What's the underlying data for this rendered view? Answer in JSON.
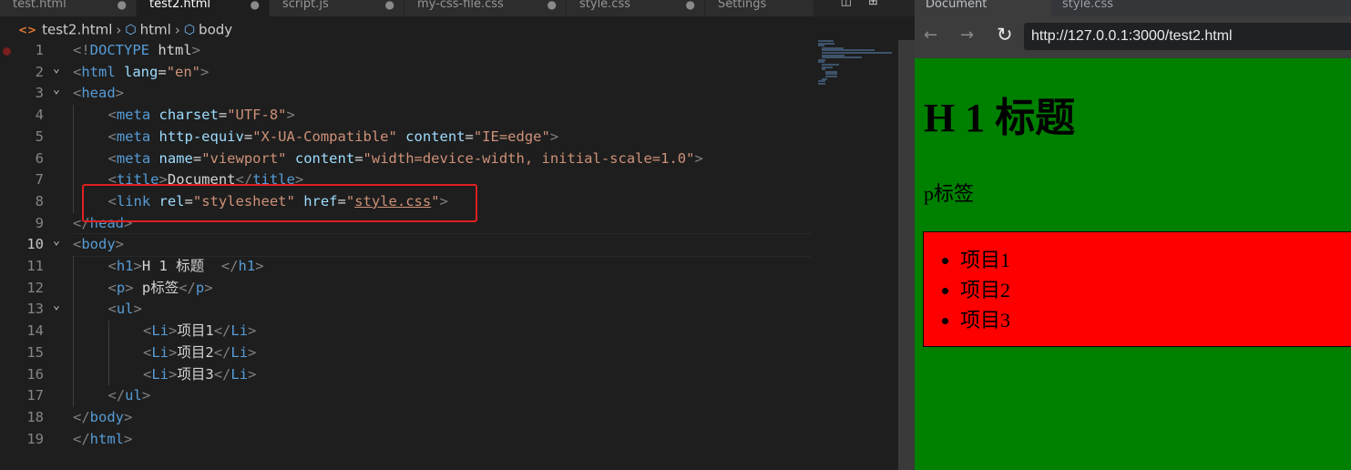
{
  "editor": {
    "tabs": [
      {
        "label": "test.html",
        "modified": "●",
        "active": false
      },
      {
        "label": "test2.html",
        "modified": "●",
        "active": true
      },
      {
        "label": "script.js",
        "modified": "●",
        "active": false
      },
      {
        "label": "my-css-file.css",
        "modified": "●",
        "active": false
      },
      {
        "label": "style.css",
        "modified": "●",
        "active": false
      },
      {
        "label": "Settings",
        "modified": "",
        "active": false
      }
    ],
    "breadcrumb": {
      "file": "test2.html",
      "items": [
        "html",
        "body"
      ]
    },
    "current_line": 10,
    "lines": [
      {
        "n": "1",
        "fold": "",
        "indent": 0,
        "tokens": [
          [
            "punct",
            "<!"
          ],
          [
            "tag",
            "DOCTYPE"
          ],
          [
            "txt",
            " html"
          ],
          [
            "punct",
            ">"
          ]
        ]
      },
      {
        "n": "2",
        "fold": "v",
        "indent": 0,
        "tokens": [
          [
            "punct",
            "<"
          ],
          [
            "tag",
            "html"
          ],
          [
            "txt",
            " "
          ],
          [
            "attr",
            "lang"
          ],
          [
            "txt",
            "="
          ],
          [
            "str",
            "\"en\""
          ],
          [
            "punct",
            ">"
          ]
        ]
      },
      {
        "n": "3",
        "fold": "v",
        "indent": 0,
        "tokens": [
          [
            "punct",
            "<"
          ],
          [
            "tag",
            "head"
          ],
          [
            "punct",
            ">"
          ]
        ]
      },
      {
        "n": "4",
        "fold": "",
        "indent": 1,
        "tokens": [
          [
            "punct",
            "<"
          ],
          [
            "tag",
            "meta"
          ],
          [
            "txt",
            " "
          ],
          [
            "attr",
            "charset"
          ],
          [
            "txt",
            "="
          ],
          [
            "str",
            "\"UTF-8\""
          ],
          [
            "punct",
            ">"
          ]
        ]
      },
      {
        "n": "5",
        "fold": "",
        "indent": 1,
        "tokens": [
          [
            "punct",
            "<"
          ],
          [
            "tag",
            "meta"
          ],
          [
            "txt",
            " "
          ],
          [
            "attr",
            "http-equiv"
          ],
          [
            "txt",
            "="
          ],
          [
            "str",
            "\"X-UA-Compatible\""
          ],
          [
            "txt",
            " "
          ],
          [
            "attr",
            "content"
          ],
          [
            "txt",
            "="
          ],
          [
            "str",
            "\"IE=edge\""
          ],
          [
            "punct",
            ">"
          ]
        ]
      },
      {
        "n": "6",
        "fold": "",
        "indent": 1,
        "tokens": [
          [
            "punct",
            "<"
          ],
          [
            "tag",
            "meta"
          ],
          [
            "txt",
            " "
          ],
          [
            "attr",
            "name"
          ],
          [
            "txt",
            "="
          ],
          [
            "str",
            "\"viewport\""
          ],
          [
            "txt",
            " "
          ],
          [
            "attr",
            "content"
          ],
          [
            "txt",
            "="
          ],
          [
            "str",
            "\"width=device-width, initial-scale=1.0\""
          ],
          [
            "punct",
            ">"
          ]
        ]
      },
      {
        "n": "7",
        "fold": "",
        "indent": 1,
        "tokens": [
          [
            "punct",
            "<"
          ],
          [
            "tag",
            "title"
          ],
          [
            "punct",
            ">"
          ],
          [
            "txt",
            "Document"
          ],
          [
            "punct",
            "</"
          ],
          [
            "tag",
            "title"
          ],
          [
            "punct",
            ">"
          ]
        ]
      },
      {
        "n": "8",
        "fold": "",
        "indent": 1,
        "tokens": [
          [
            "punct",
            "<"
          ],
          [
            "tag",
            "link"
          ],
          [
            "txt",
            " "
          ],
          [
            "attr",
            "rel"
          ],
          [
            "txt",
            "="
          ],
          [
            "str",
            "\"stylesheet\""
          ],
          [
            "txt",
            " "
          ],
          [
            "attr",
            "href"
          ],
          [
            "txt",
            "="
          ],
          [
            "str",
            "\""
          ],
          [
            "strul",
            "style.css"
          ],
          [
            "str",
            "\""
          ],
          [
            "punct",
            ">"
          ]
        ]
      },
      {
        "n": "9",
        "fold": "",
        "indent": 0,
        "tokens": [
          [
            "punct",
            "</"
          ],
          [
            "tag",
            "head"
          ],
          [
            "punct",
            ">"
          ]
        ]
      },
      {
        "n": "10",
        "fold": "v",
        "indent": 0,
        "tokens": [
          [
            "punct",
            "<"
          ],
          [
            "tag",
            "body"
          ],
          [
            "punct",
            ">"
          ]
        ]
      },
      {
        "n": "11",
        "fold": "",
        "indent": 1,
        "tokens": [
          [
            "punct",
            "<"
          ],
          [
            "tag",
            "h1"
          ],
          [
            "punct",
            ">"
          ],
          [
            "txt",
            "H 1 标题  "
          ],
          [
            "punct",
            "</"
          ],
          [
            "tag",
            "h1"
          ],
          [
            "punct",
            ">"
          ]
        ]
      },
      {
        "n": "12",
        "fold": "",
        "indent": 1,
        "tokens": [
          [
            "punct",
            "<"
          ],
          [
            "tag",
            "p"
          ],
          [
            "punct",
            ">"
          ],
          [
            "txt",
            " p标签"
          ],
          [
            "punct",
            "</"
          ],
          [
            "tag",
            "p"
          ],
          [
            "punct",
            ">"
          ]
        ]
      },
      {
        "n": "13",
        "fold": "v",
        "indent": 1,
        "tokens": [
          [
            "punct",
            "<"
          ],
          [
            "tag",
            "ul"
          ],
          [
            "punct",
            ">"
          ]
        ]
      },
      {
        "n": "14",
        "fold": "",
        "indent": 2,
        "tokens": [
          [
            "punct",
            "<"
          ],
          [
            "tag",
            "Li"
          ],
          [
            "punct",
            ">"
          ],
          [
            "txt",
            "项目1"
          ],
          [
            "punct",
            "</"
          ],
          [
            "tag",
            "Li"
          ],
          [
            "punct",
            ">"
          ]
        ]
      },
      {
        "n": "15",
        "fold": "",
        "indent": 2,
        "tokens": [
          [
            "punct",
            "<"
          ],
          [
            "tag",
            "Li"
          ],
          [
            "punct",
            ">"
          ],
          [
            "txt",
            "项目2"
          ],
          [
            "punct",
            "</"
          ],
          [
            "tag",
            "Li"
          ],
          [
            "punct",
            ">"
          ]
        ]
      },
      {
        "n": "16",
        "fold": "",
        "indent": 2,
        "tokens": [
          [
            "punct",
            "<"
          ],
          [
            "tag",
            "Li"
          ],
          [
            "punct",
            ">"
          ],
          [
            "txt",
            "项目3"
          ],
          [
            "punct",
            "</"
          ],
          [
            "tag",
            "Li"
          ],
          [
            "punct",
            ">"
          ]
        ]
      },
      {
        "n": "17",
        "fold": "",
        "indent": 1,
        "tokens": [
          [
            "punct",
            "</"
          ],
          [
            "tag",
            "ul"
          ],
          [
            "punct",
            ">"
          ]
        ]
      },
      {
        "n": "18",
        "fold": "",
        "indent": 0,
        "tokens": [
          [
            "punct",
            "</"
          ],
          [
            "tag",
            "body"
          ],
          [
            "punct",
            ">"
          ]
        ]
      },
      {
        "n": "19",
        "fold": "",
        "indent": 0,
        "tokens": [
          [
            "punct",
            "</"
          ],
          [
            "tag",
            "html"
          ],
          [
            "punct",
            ">"
          ]
        ]
      }
    ]
  },
  "browser": {
    "tabs": [
      {
        "label": "Document",
        "active": true
      },
      {
        "label": "style.css",
        "active": false
      }
    ],
    "back_icon": "←",
    "forward_icon": "→",
    "reload_icon": "↻",
    "url": "http://127.0.0.1:3000/test2.html",
    "page": {
      "h1": "H 1 标题",
      "p": "p标签",
      "items": [
        "项目1",
        "项目2",
        "项目3"
      ],
      "body_bg": "#008000",
      "ul_bg": "#ff0000"
    }
  },
  "colors": {
    "highlight_box": "#e02020"
  }
}
